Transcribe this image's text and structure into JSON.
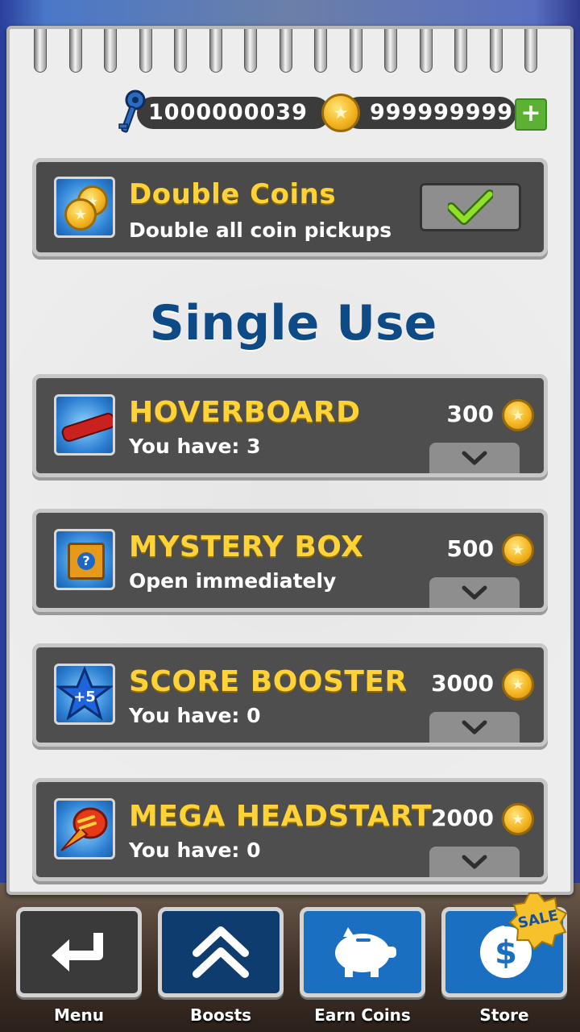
{
  "header": {
    "keys": "1000000039",
    "coins": "999999999",
    "add_label": "+"
  },
  "double_coins": {
    "title": "Double Coins",
    "subtitle": "Double all coin pickups",
    "status": "owned"
  },
  "section_title": "Single Use",
  "items": [
    {
      "title": "HOVERBOARD",
      "subtitle": "You have: 3",
      "price": "300",
      "icon": "hoverboard-icon"
    },
    {
      "title": "MYSTERY BOX",
      "subtitle": "Open immediately",
      "price": "500",
      "icon": "mystery-box-icon"
    },
    {
      "title": "SCORE BOOSTER",
      "subtitle": "You have: 0",
      "price": "3000",
      "icon": "score-booster-icon"
    },
    {
      "title": "MEGA HEADSTART",
      "subtitle": "You have: 0",
      "price": "2000",
      "icon": "headstart-icon"
    }
  ],
  "score_booster_badge": "+5",
  "mystery_mark": "?",
  "nav": [
    {
      "label": "Menu",
      "icon": "back-arrow-icon"
    },
    {
      "label": "Boosts",
      "icon": "double-chevron-up-icon"
    },
    {
      "label": "Earn Coins",
      "icon": "piggy-bank-icon"
    },
    {
      "label": "Store",
      "icon": "dollar-coin-icon",
      "badge": "SALE"
    }
  ],
  "colors": {
    "accent_yellow": "#ffd237",
    "title_blue": "#0d4a86",
    "nav_dark": "#3a3a3a",
    "nav_blue": "#1b6fc0",
    "plus_green": "#5cb135"
  }
}
